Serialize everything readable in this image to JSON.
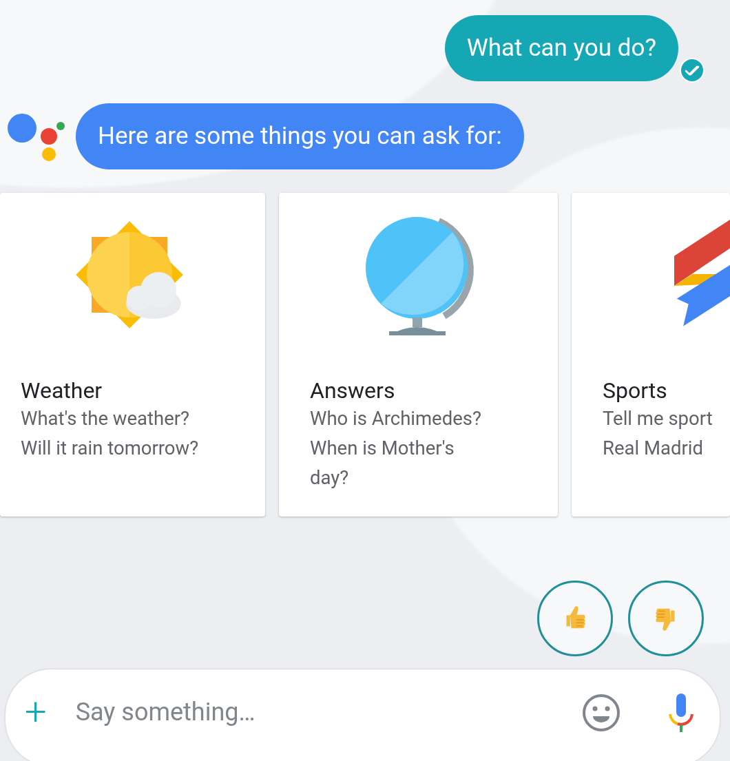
{
  "conversation": [
    {
      "kind": "user",
      "text": "What can you do?",
      "delivered": true
    },
    {
      "kind": "assistant",
      "text": "Here are some things you can ask for:"
    }
  ],
  "suggestion_cards": [
    {
      "kind": "weather",
      "title": "Weather",
      "examples": [
        "What's the weather?",
        "Will it rain tomorrow?"
      ]
    },
    {
      "kind": "answers",
      "title": "Answers",
      "examples": [
        "Who is Archimedes?",
        "When is Mother's day?"
      ]
    },
    {
      "kind": "sports",
      "title": "Sports",
      "examples": [
        "Tell me sport",
        "Real Madrid"
      ]
    }
  ],
  "composer": {
    "add_button": "+",
    "placeholder": "Say something…"
  }
}
